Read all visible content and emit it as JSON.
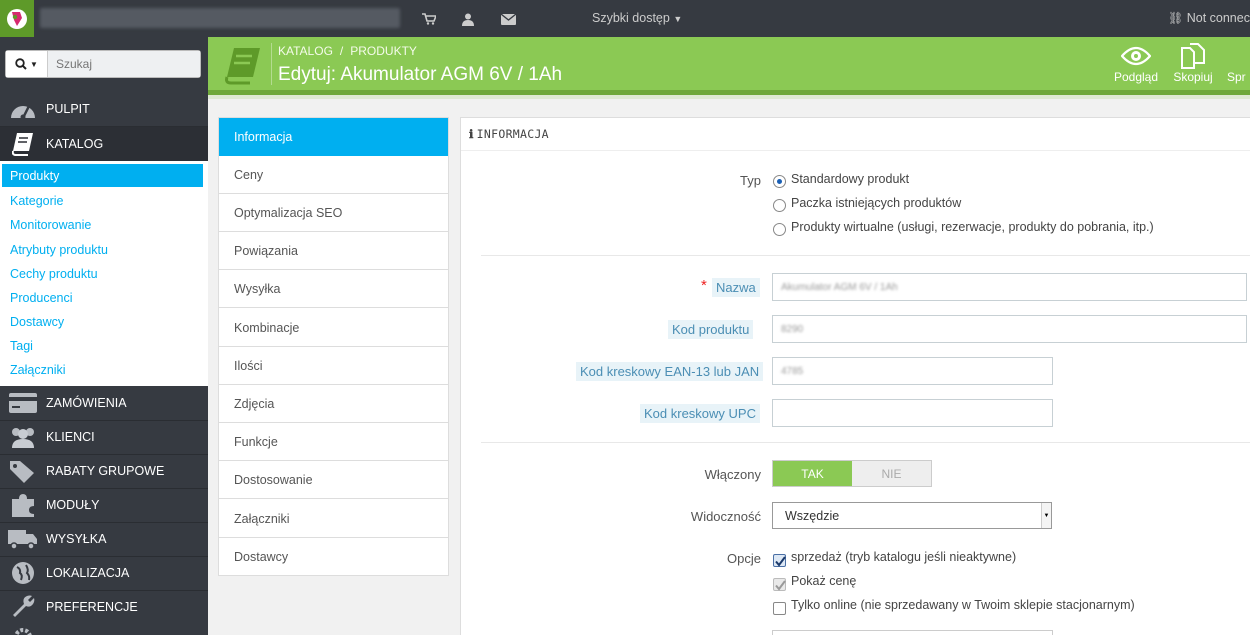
{
  "topbar": {
    "quick_access": "Szybki dostęp",
    "not_connected": "Not connect"
  },
  "search": {
    "placeholder": "Szukaj"
  },
  "sidebar": {
    "items": [
      {
        "label": "PULPIT",
        "icon": "dashboard-icon"
      },
      {
        "label": "KATALOG",
        "icon": "book-icon"
      },
      {
        "label": "ZAMÓWIENIA",
        "icon": "credit-card-icon"
      },
      {
        "label": "KLIENCI",
        "icon": "users-icon"
      },
      {
        "label": "RABATY GRUPOWE",
        "icon": "tags-icon"
      },
      {
        "label": "MODUŁY",
        "icon": "puzzle-icon"
      },
      {
        "label": "WYSYŁKA",
        "icon": "truck-icon"
      },
      {
        "label": "LOKALIZACJA",
        "icon": "globe-icon"
      },
      {
        "label": "PREFERENCJE",
        "icon": "wrench-icon"
      }
    ],
    "submenu": [
      "Produkty",
      "Kategorie",
      "Monitorowanie",
      "Atrybuty produktu",
      "Cechy produktu",
      "Producenci",
      "Dostawcy",
      "Tagi",
      "Załączniki"
    ]
  },
  "header": {
    "breadcrumb": [
      "KATALOG",
      "PRODUKTY"
    ],
    "title": "Edytuj: Akumulator AGM 6V / 1Ah",
    "toolbar": [
      "Podgląd",
      "Skopiuj",
      "Spr"
    ]
  },
  "tabs": [
    "Informacja",
    "Ceny",
    "Optymalizacja SEO",
    "Powiązania",
    "Wysyłka",
    "Kombinacje",
    "Ilości",
    "Zdjęcia",
    "Funkcje",
    "Dostosowanie",
    "Załączniki",
    "Dostawcy"
  ],
  "panel": {
    "heading": "INFORMACJA",
    "type_label": "Typ",
    "type_options": [
      "Standardowy produkt",
      "Paczka istniejących produktów",
      "Produkty wirtualne (usługi, rezerwacje, produkty do pobrania, itp.)"
    ],
    "name_label": "Nazwa",
    "name_value": "Akumulator AGM 6V / 1Ah",
    "code_label": "Kod produktu",
    "code_value": "8290",
    "ean_label": "Kod kreskowy EAN-13 lub JAN",
    "ean_value": "4785",
    "upc_label": "Kod kreskowy UPC",
    "upc_value": "",
    "enabled_label": "Włączony",
    "enabled_yes": "TAK",
    "enabled_no": "NIE",
    "visibility_label": "Widoczność",
    "visibility_value": "Wszędzie",
    "options_label": "Opcje",
    "options": [
      "sprzedaż (tryb katalogu jeśli nieaktywne)",
      "Pokaż cenę",
      "Tylko online (nie sprzedawany w Twoim sklepie stacjonarnym)"
    ]
  },
  "colors": {
    "header_green": "#8bc954",
    "accent_blue": "#00aff0",
    "sidebar_dark": "#363a41"
  }
}
